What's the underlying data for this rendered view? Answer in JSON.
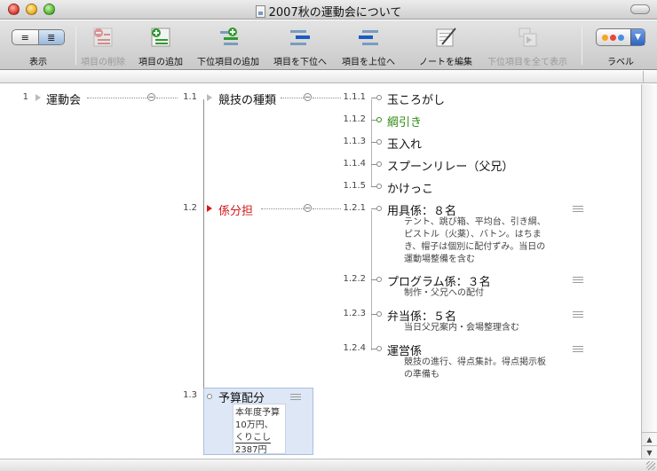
{
  "window": {
    "title": "2007秋の運動会について"
  },
  "toolbar": {
    "view_label": "表示",
    "view_seg_left": "≡",
    "view_seg_right": "≣",
    "delete_label": "項目の削除",
    "add_label": "項目の追加",
    "add_child_label": "下位項目の追加",
    "demote_label": "項目を下位へ",
    "promote_label": "項目を上位へ",
    "edit_note_label": "ノートを編集",
    "show_children_label": "下位項目を全て表示",
    "label_label": "ラベル",
    "label_arrow": "▼",
    "label_dot_colors": [
      "#f5a623",
      "#e8473a",
      "#4a90e2"
    ]
  },
  "colors": {
    "red_node": "#d0181a",
    "green_node": "#2f8a13",
    "selection_bg": "#dde7f5"
  },
  "outline": {
    "root": {
      "num": "1",
      "text": "運動会"
    },
    "level1": [
      {
        "num": "1.1",
        "text": "競技の種類"
      },
      {
        "num": "1.2",
        "text": "係分担"
      },
      {
        "num": "1.3",
        "text": "予算配分"
      }
    ],
    "games": [
      {
        "num": "1.1.1",
        "text": "玉ころがし"
      },
      {
        "num": "1.1.2",
        "text": "綱引き"
      },
      {
        "num": "1.1.3",
        "text": "玉入れ"
      },
      {
        "num": "1.1.4",
        "text": "スプーンリレー（父兄）"
      },
      {
        "num": "1.1.5",
        "text": "かけっこ"
      }
    ],
    "roles": [
      {
        "num": "1.2.1",
        "text": "用具係：８名",
        "note": [
          "テント、跳び箱、平均台、引き綱、",
          "ピストル（火薬）、バトン。はちま",
          "き、帽子は個別に配付ずみ。当日の",
          "運動場整備を含む"
        ]
      },
      {
        "num": "1.2.2",
        "text": "プログラム係：３名",
        "note": [
          "制作・父兄への配付"
        ]
      },
      {
        "num": "1.2.3",
        "text": "弁当係：５名",
        "note": [
          "当日父兄案内・会場整理含む"
        ]
      },
      {
        "num": "1.2.4",
        "text": "運営係",
        "note": [
          "競技の進行、得点集計。得点掲示板",
          "の準備も"
        ]
      }
    ],
    "budget_note": [
      "本年度予算",
      "10万円、",
      "くりこし",
      "2387円"
    ]
  }
}
